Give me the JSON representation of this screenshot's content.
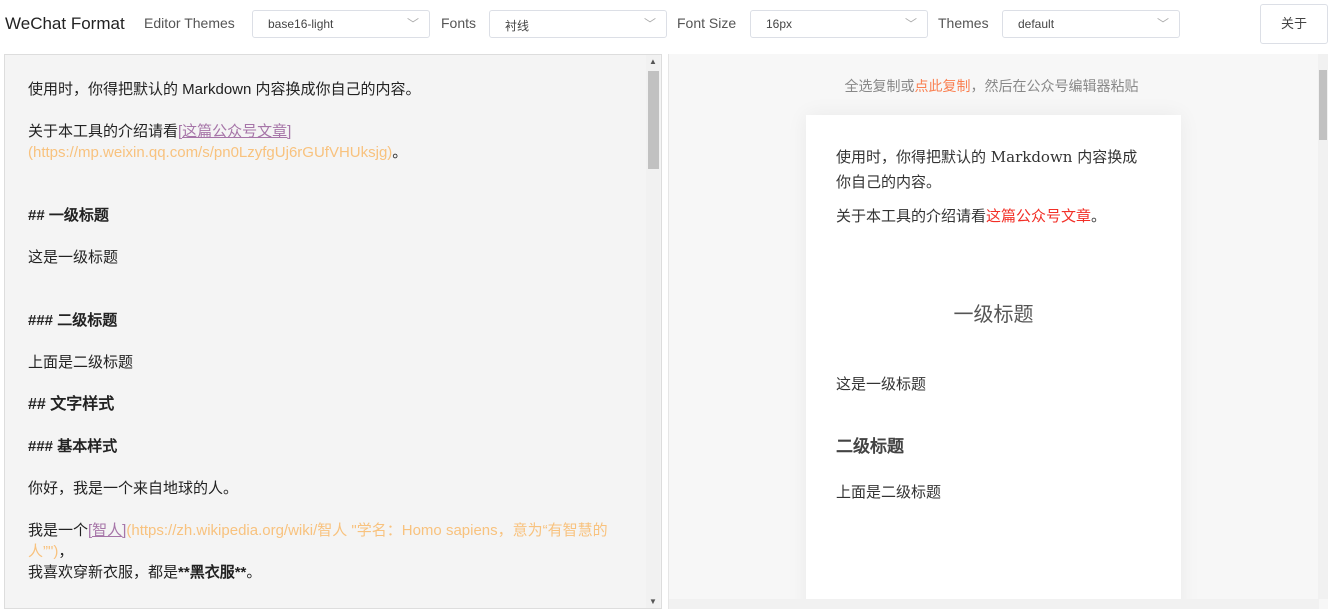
{
  "header": {
    "title": "WeChat Format",
    "editor_themes_label": "Editor Themes",
    "editor_theme": "base16-light",
    "fonts_label": "Fonts",
    "font": "衬线",
    "font_size_label": "Font Size",
    "font_size": "16px",
    "themes_label": "Themes",
    "theme": "default",
    "about": "关于"
  },
  "editor": {
    "l1": "使用时，你得把默认的 Markdown 内容换成你自己的内容。",
    "l2a": "关于本工具的介绍请看",
    "l2link": "[这篇公众号文章]",
    "l2url": "(https://mp.weixin.qq.com/s/pn0LzyfgUj6rGUfVHUksjg)",
    "l2end": "。",
    "h1": "## 一级标题",
    "p1": "这是一级标题",
    "h2": "### 二级标题",
    "p2": "上面是二级标题",
    "h3": "## 文字样式",
    "h4": "### 基本样式",
    "p3": "你好，我是一个来自地球的人。",
    "p4a": "我是一个",
    "p4link": "[智人]",
    "p4url": "(https://zh.wikipedia.org/wiki/智人 \"学名：Homo sapiens，意为“有智慧的人”\")",
    "p4end": "，",
    "p5a": "我喜欢穿新衣服，都是",
    "p5b": "**黑衣服**",
    "p5c": "。"
  },
  "preview": {
    "tip_a": "全选复制或",
    "tip_link": "点此复制",
    "tip_b": "，然后在公众号编辑器粘贴",
    "p1": "使用时，你得把默认的 Markdown 内容换成你自己的内容。",
    "p2a": "关于本工具的介绍请看",
    "p2link": "这篇公众号文章",
    "p2end": "。",
    "h1": "一级标题",
    "p3": "这是一级标题",
    "h2": "二级标题",
    "p4": "上面是二级标题"
  }
}
